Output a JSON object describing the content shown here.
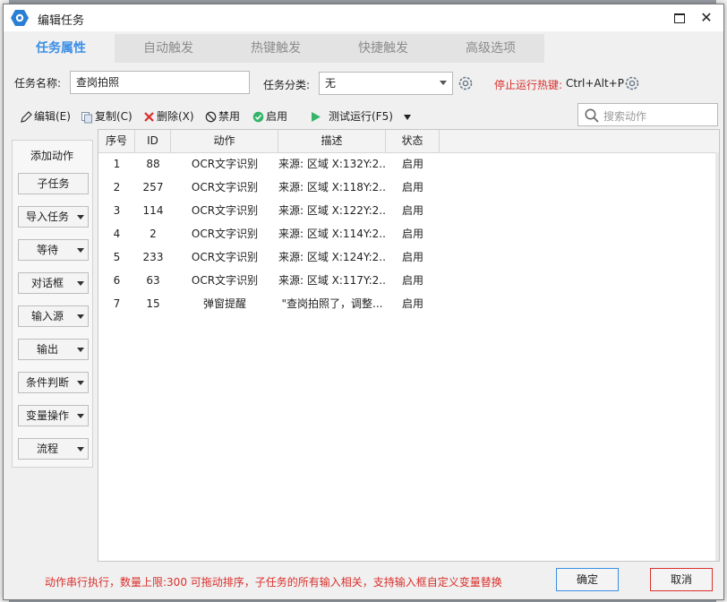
{
  "window": {
    "title": "编辑任务"
  },
  "tabs": [
    {
      "label": "任务属性"
    },
    {
      "label": "自动触发"
    },
    {
      "label": "热键触发"
    },
    {
      "label": "快捷触发"
    },
    {
      "label": "高级选项"
    }
  ],
  "form": {
    "name_label": "任务名称:",
    "name_value": "查岗拍照",
    "category_label": "任务分类:",
    "category_value": "无",
    "hotkey_label": "停止运行热键:",
    "hotkey_value": "Ctrl+Alt+P"
  },
  "toolbar": {
    "edit": "编辑(E)",
    "copy": "复制(C)",
    "delete": "删除(X)",
    "disable": "禁用",
    "enable": "启用",
    "test_run": "测试运行(F5)"
  },
  "search": {
    "placeholder": "搜索动作"
  },
  "actions_panel": {
    "title": "添加动作",
    "buttons": [
      "子任务",
      "导入任务",
      "等待",
      "对话框",
      "输入源",
      "输出",
      "条件判断",
      "变量操作",
      "流程"
    ]
  },
  "table": {
    "columns": [
      "序号",
      "ID",
      "动作",
      "描述",
      "状态"
    ],
    "rows": [
      [
        "1",
        "88",
        "OCR文字识别",
        "来源: 区域 X:132Y:2...",
        "启用"
      ],
      [
        "2",
        "257",
        "OCR文字识别",
        "来源: 区域 X:118Y:2...",
        "启用"
      ],
      [
        "3",
        "114",
        "OCR文字识别",
        "来源: 区域 X:122Y:2...",
        "启用"
      ],
      [
        "4",
        "2",
        "OCR文字识别",
        "来源: 区域 X:114Y:2...",
        "启用"
      ],
      [
        "5",
        "233",
        "OCR文字识别",
        "来源: 区域 X:124Y:2...",
        "启用"
      ],
      [
        "6",
        "63",
        "OCR文字识别",
        "来源: 区域 X:117Y:2...",
        "启用"
      ],
      [
        "7",
        "15",
        "弹窗提醒",
        "\"查岗拍照了，调整...",
        "启用"
      ]
    ]
  },
  "footer": {
    "note": "动作串行执行，数量上限:300  可拖动排序，子任务的所有输入相关，支持输入框自定义变量替换",
    "ok": "确定",
    "cancel": "取消"
  },
  "colors": {
    "accent": "#3a8ee6",
    "warning": "#d9302c"
  }
}
